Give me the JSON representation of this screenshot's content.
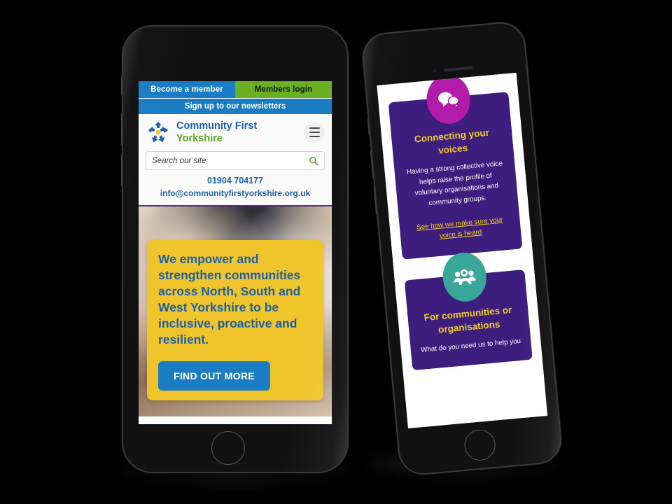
{
  "scene": {
    "background_color": "#000000",
    "description": "Two smartphone mockups displaying a responsive charity website"
  },
  "left_phone": {
    "device_name": "smartphone-mockup-front",
    "camera_icon": "front-camera-icon",
    "speaker_icon": "earpiece-speaker-icon",
    "home_button_icon": "home-button-icon",
    "site": {
      "topbar": {
        "become_member": "Become a member",
        "members_login": "Members login",
        "newsletter": "Sign up to our newsletters"
      },
      "brand": {
        "logo_icon": "community-first-yorkshire-logo-icon",
        "line1": "Community First",
        "line2": "Yorkshire"
      },
      "menu_icon": "hamburger-menu-icon",
      "search": {
        "placeholder": "Search our site",
        "value": "",
        "icon": "search-icon"
      },
      "contact": {
        "phone": "01904 704177",
        "email": "info@communityfirstyorkshire.org.uk"
      },
      "hero": {
        "heading": "We empower and strengthen communities across North, South and West Yorkshire to be inclusive, proactive and resilient.",
        "cta_label": "FIND OUT MORE"
      }
    },
    "colors": {
      "blue": "#1a7dc4",
      "green": "#6ab023",
      "brand_blue": "#1c5fa8",
      "brand_green": "#5aa81e",
      "yellow": "#f0c52c",
      "purple_divider": "#5a2d82"
    }
  },
  "right_phone": {
    "device_name": "smartphone-mockup-angled",
    "camera_icon": "front-camera-icon",
    "speaker_icon": "earpiece-speaker-icon",
    "home_button_icon": "home-button-icon",
    "cards": [
      {
        "icon": "speech-bubbles-icon",
        "icon_color": "#b31bab",
        "title": "Connecting your voices",
        "body": "Having a strong collective voice helps raise the profile of voluntary organisations and community groups.",
        "link": "See how we make sure your voice is heard"
      },
      {
        "icon": "people-group-icon",
        "icon_color": "#3aa79b",
        "title": "For communities or organisations",
        "body": "What do you need us to help you",
        "link": ""
      }
    ],
    "colors": {
      "card_purple": "#3d1d7e",
      "heading_yellow": "#f5d020",
      "magenta": "#b31bab",
      "teal": "#3aa79b"
    }
  }
}
